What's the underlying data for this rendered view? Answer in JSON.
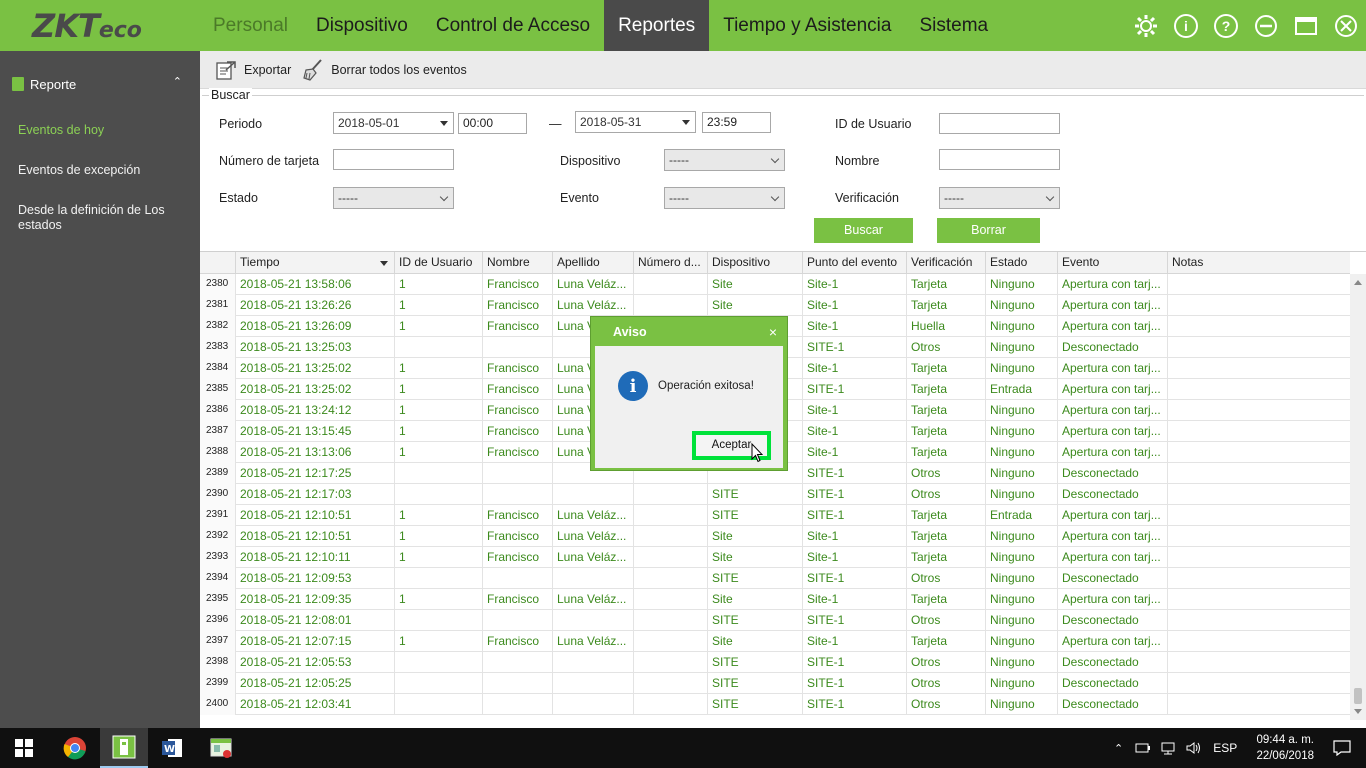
{
  "app": {
    "logo": "ZKTeco",
    "nav": [
      "Personal",
      "Dispositivo",
      "Control de Acceso",
      "Reportes",
      "Tiempo y Asistencia",
      "Sistema"
    ],
    "active_nav": "Reportes",
    "colors": {
      "brand_green": "#7ac143",
      "sidebar": "#4d4d4d",
      "row_text": "#3c8a1d",
      "highlight": "#00e23a"
    }
  },
  "sidebar": {
    "section": "Reporte",
    "items": [
      "Eventos de hoy",
      "Eventos de excepción",
      "Desde la definición de Los estados"
    ],
    "active": "Eventos de hoy"
  },
  "toolbar": {
    "export_label": "Exportar",
    "clear_label": "Borrar todos los eventos"
  },
  "search": {
    "legend": "Buscar",
    "periodo_label": "Periodo",
    "start_date": "2018-05-01",
    "start_time": "00:00",
    "dash": "—",
    "end_date": "2018-05-31",
    "end_time": "23:59",
    "user_id_label": "ID de Usuario",
    "card_label": "Número de tarjeta",
    "device_label": "Dispositivo",
    "device_value": "-----",
    "name_label": "Nombre",
    "state_label": "Estado",
    "state_value": "-----",
    "event_label": "Evento",
    "event_value": "-----",
    "verification_label": "Verificación",
    "verification_value": "-----",
    "search_button": "Buscar",
    "clear_button": "Borrar"
  },
  "table": {
    "headers": [
      "Tiempo",
      "ID de Usuario",
      "Nombre",
      "Apellido",
      "Número d...",
      "Dispositivo",
      "Punto del evento",
      "Verificación",
      "Estado",
      "Evento",
      "Notas"
    ],
    "rows": [
      [
        "2380",
        "2018-05-21 13:58:06",
        "1",
        "Francisco",
        "Luna Veláz...",
        "",
        "Site",
        "Site-1",
        "Tarjeta",
        "Ninguno",
        "Apertura con tarj...",
        ""
      ],
      [
        "2381",
        "2018-05-21 13:26:26",
        "1",
        "Francisco",
        "Luna Veláz...",
        "",
        "Site",
        "Site-1",
        "Tarjeta",
        "Ninguno",
        "Apertura con tarj...",
        ""
      ],
      [
        "2382",
        "2018-05-21 13:26:09",
        "1",
        "Francisco",
        "Luna V",
        "",
        "",
        "Site-1",
        "Huella",
        "Ninguno",
        "Apertura con tarj...",
        ""
      ],
      [
        "2383",
        "2018-05-21 13:25:03",
        "",
        "",
        "",
        "",
        "",
        "SITE-1",
        "Otros",
        "Ninguno",
        "Desconectado",
        ""
      ],
      [
        "2384",
        "2018-05-21 13:25:02",
        "1",
        "Francisco",
        "Luna V",
        "",
        "",
        "Site-1",
        "Tarjeta",
        "Ninguno",
        "Apertura con tarj...",
        ""
      ],
      [
        "2385",
        "2018-05-21 13:25:02",
        "1",
        "Francisco",
        "Luna V",
        "",
        "",
        "SITE-1",
        "Tarjeta",
        "Entrada",
        "Apertura con tarj...",
        ""
      ],
      [
        "2386",
        "2018-05-21 13:24:12",
        "1",
        "Francisco",
        "Luna V",
        "",
        "",
        "Site-1",
        "Tarjeta",
        "Ninguno",
        "Apertura con tarj...",
        ""
      ],
      [
        "2387",
        "2018-05-21 13:15:45",
        "1",
        "Francisco",
        "Luna V",
        "",
        "",
        "Site-1",
        "Tarjeta",
        "Ninguno",
        "Apertura con tarj...",
        ""
      ],
      [
        "2388",
        "2018-05-21 13:13:06",
        "1",
        "Francisco",
        "Luna V",
        "",
        "",
        "Site-1",
        "Tarjeta",
        "Ninguno",
        "Apertura con tarj...",
        ""
      ],
      [
        "2389",
        "2018-05-21 12:17:25",
        "",
        "",
        "",
        "",
        "",
        "SITE-1",
        "Otros",
        "Ninguno",
        "Desconectado",
        ""
      ],
      [
        "2390",
        "2018-05-21 12:17:03",
        "",
        "",
        "",
        "",
        "SITE",
        "SITE-1",
        "Otros",
        "Ninguno",
        "Desconectado",
        ""
      ],
      [
        "2391",
        "2018-05-21 12:10:51",
        "1",
        "Francisco",
        "Luna Veláz...",
        "",
        "SITE",
        "SITE-1",
        "Tarjeta",
        "Entrada",
        "Apertura con tarj...",
        ""
      ],
      [
        "2392",
        "2018-05-21 12:10:51",
        "1",
        "Francisco",
        "Luna Veláz...",
        "",
        "Site",
        "Site-1",
        "Tarjeta",
        "Ninguno",
        "Apertura con tarj...",
        ""
      ],
      [
        "2393",
        "2018-05-21 12:10:11",
        "1",
        "Francisco",
        "Luna Veláz...",
        "",
        "Site",
        "Site-1",
        "Tarjeta",
        "Ninguno",
        "Apertura con tarj...",
        ""
      ],
      [
        "2394",
        "2018-05-21 12:09:53",
        "",
        "",
        "",
        "",
        "SITE",
        "SITE-1",
        "Otros",
        "Ninguno",
        "Desconectado",
        ""
      ],
      [
        "2395",
        "2018-05-21 12:09:35",
        "1",
        "Francisco",
        "Luna Veláz...",
        "",
        "Site",
        "Site-1",
        "Tarjeta",
        "Ninguno",
        "Apertura con tarj...",
        ""
      ],
      [
        "2396",
        "2018-05-21 12:08:01",
        "",
        "",
        "",
        "",
        "SITE",
        "SITE-1",
        "Otros",
        "Ninguno",
        "Desconectado",
        ""
      ],
      [
        "2397",
        "2018-05-21 12:07:15",
        "1",
        "Francisco",
        "Luna Veláz...",
        "",
        "Site",
        "Site-1",
        "Tarjeta",
        "Ninguno",
        "Apertura con tarj...",
        ""
      ],
      [
        "2398",
        "2018-05-21 12:05:53",
        "",
        "",
        "",
        "",
        "SITE",
        "SITE-1",
        "Otros",
        "Ninguno",
        "Desconectado",
        ""
      ],
      [
        "2399",
        "2018-05-21 12:05:25",
        "",
        "",
        "",
        "",
        "SITE",
        "SITE-1",
        "Otros",
        "Ninguno",
        "Desconectado",
        ""
      ],
      [
        "2400",
        "2018-05-21 12:03:41",
        "",
        "",
        "",
        "",
        "SITE",
        "SITE-1",
        "Otros",
        "Ninguno",
        "Desconectado",
        ""
      ]
    ]
  },
  "modal": {
    "title": "Aviso",
    "close": "×",
    "icon": "info-icon",
    "message": "Operación exitosa!",
    "ok_button": "Aceptar"
  },
  "taskbar": {
    "apps": [
      "windows-start-icon",
      "chrome-icon",
      "zkteco-app-icon",
      "word-icon",
      "app-window-icon"
    ],
    "language": "ESP",
    "time": "09:44 a. m.",
    "date": "22/06/2018"
  }
}
